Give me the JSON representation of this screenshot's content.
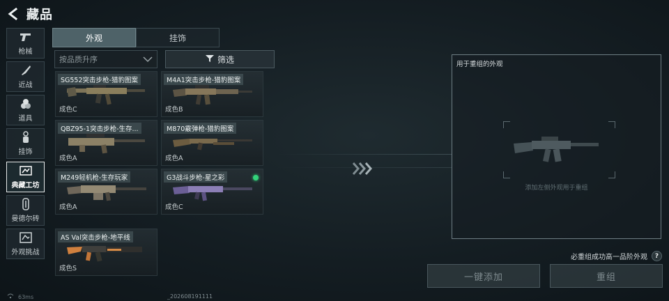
{
  "header": {
    "title": "藏品"
  },
  "categories": [
    {
      "label": "枪械",
      "icon": "pistol-icon"
    },
    {
      "label": "近战",
      "icon": "knife-icon"
    },
    {
      "label": "道具",
      "icon": "grenade-icon"
    },
    {
      "label": "挂饰",
      "icon": "charm-icon"
    },
    {
      "label": "典藏工坊",
      "icon": "workshop-icon",
      "active": true
    },
    {
      "label": "曼德尔砖",
      "icon": "brick-icon"
    },
    {
      "label": "外观挑战",
      "icon": "challenge-icon"
    }
  ],
  "tabs": [
    {
      "label": "外观",
      "active": true
    },
    {
      "label": "挂饰",
      "active": false
    }
  ],
  "sort": {
    "label": "按品质升序"
  },
  "filter": {
    "label": "筛选"
  },
  "items": [
    {
      "name": "SG552突击步枪-猎豹图案",
      "grade": "成色C"
    },
    {
      "name": "M4A1突击步枪-猎豹图案",
      "grade": "成色B"
    },
    {
      "name": "QBZ95-1突击步枪-生存...",
      "grade": "成色A"
    },
    {
      "name": "M870霰弹枪-猎豹图案",
      "grade": "成色A"
    },
    {
      "name": "M249轻机枪-生存玩家",
      "grade": "成色A"
    },
    {
      "name": "G3战斗步枪-星之彩",
      "grade": "成色C",
      "new": true
    },
    {
      "name": "AS Val突击步枪-地平线",
      "grade": "成色S"
    }
  ],
  "recombine": {
    "title": "用于重组的外观",
    "hint": "添加左侧外观用于重组",
    "note": "必重组成功高一品阶外观",
    "help": "?",
    "add_button": "一键添加",
    "recombine_button": "重组"
  },
  "status": {
    "ping": "63ms",
    "version": "_202608191111"
  },
  "colors": {
    "accent": "#4e6268",
    "new_dot": "#33d37a"
  }
}
